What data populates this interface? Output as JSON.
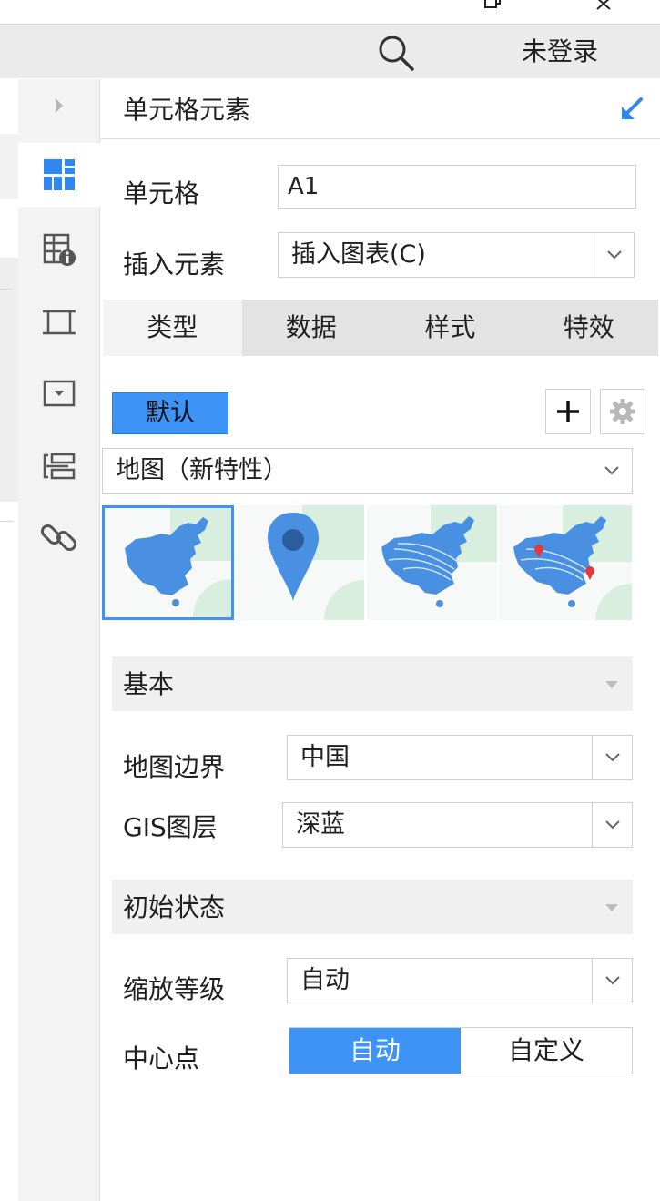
{
  "header": {
    "login_label": "未登录"
  },
  "panel": {
    "title": "单元格元素",
    "cell_label": "单元格",
    "cell_value": "A1",
    "insert_label": "插入元素",
    "insert_value": "插入图表(C)",
    "tabs": [
      {
        "label": "类型",
        "active": true
      },
      {
        "label": "数据",
        "active": false
      },
      {
        "label": "样式",
        "active": false
      },
      {
        "label": "特效",
        "active": false
      }
    ],
    "theme_label": "默认",
    "chart_type_value": "地图（新特性）",
    "map_variants": [
      "china-area-map",
      "map-marker-pin",
      "china-flow-map",
      "china-flow-point-map"
    ],
    "sections": {
      "basic": {
        "title": "基本",
        "boundary_label": "地图边界",
        "boundary_value": "中国",
        "gis_label": "GIS图层",
        "gis_value": "深蓝"
      },
      "initial": {
        "title": "初始状态",
        "zoom_label": "缩放等级",
        "zoom_value": "自动",
        "center_label": "中心点",
        "center_options": [
          {
            "label": "自动",
            "active": true
          },
          {
            "label": "自定义",
            "active": false
          }
        ]
      }
    }
  },
  "colors": {
    "accent": "#3d94f6",
    "map_blue": "#4a90e2",
    "map_bg_green": "#d8eedf",
    "pin_red": "#e23b3b"
  },
  "icons": {
    "sidebar": [
      "expand-arrow-icon",
      "cell-element-icon",
      "cell-attribute-icon",
      "border-icon",
      "widget-icon",
      "condition-attribute-icon",
      "hyperlink-icon"
    ]
  }
}
